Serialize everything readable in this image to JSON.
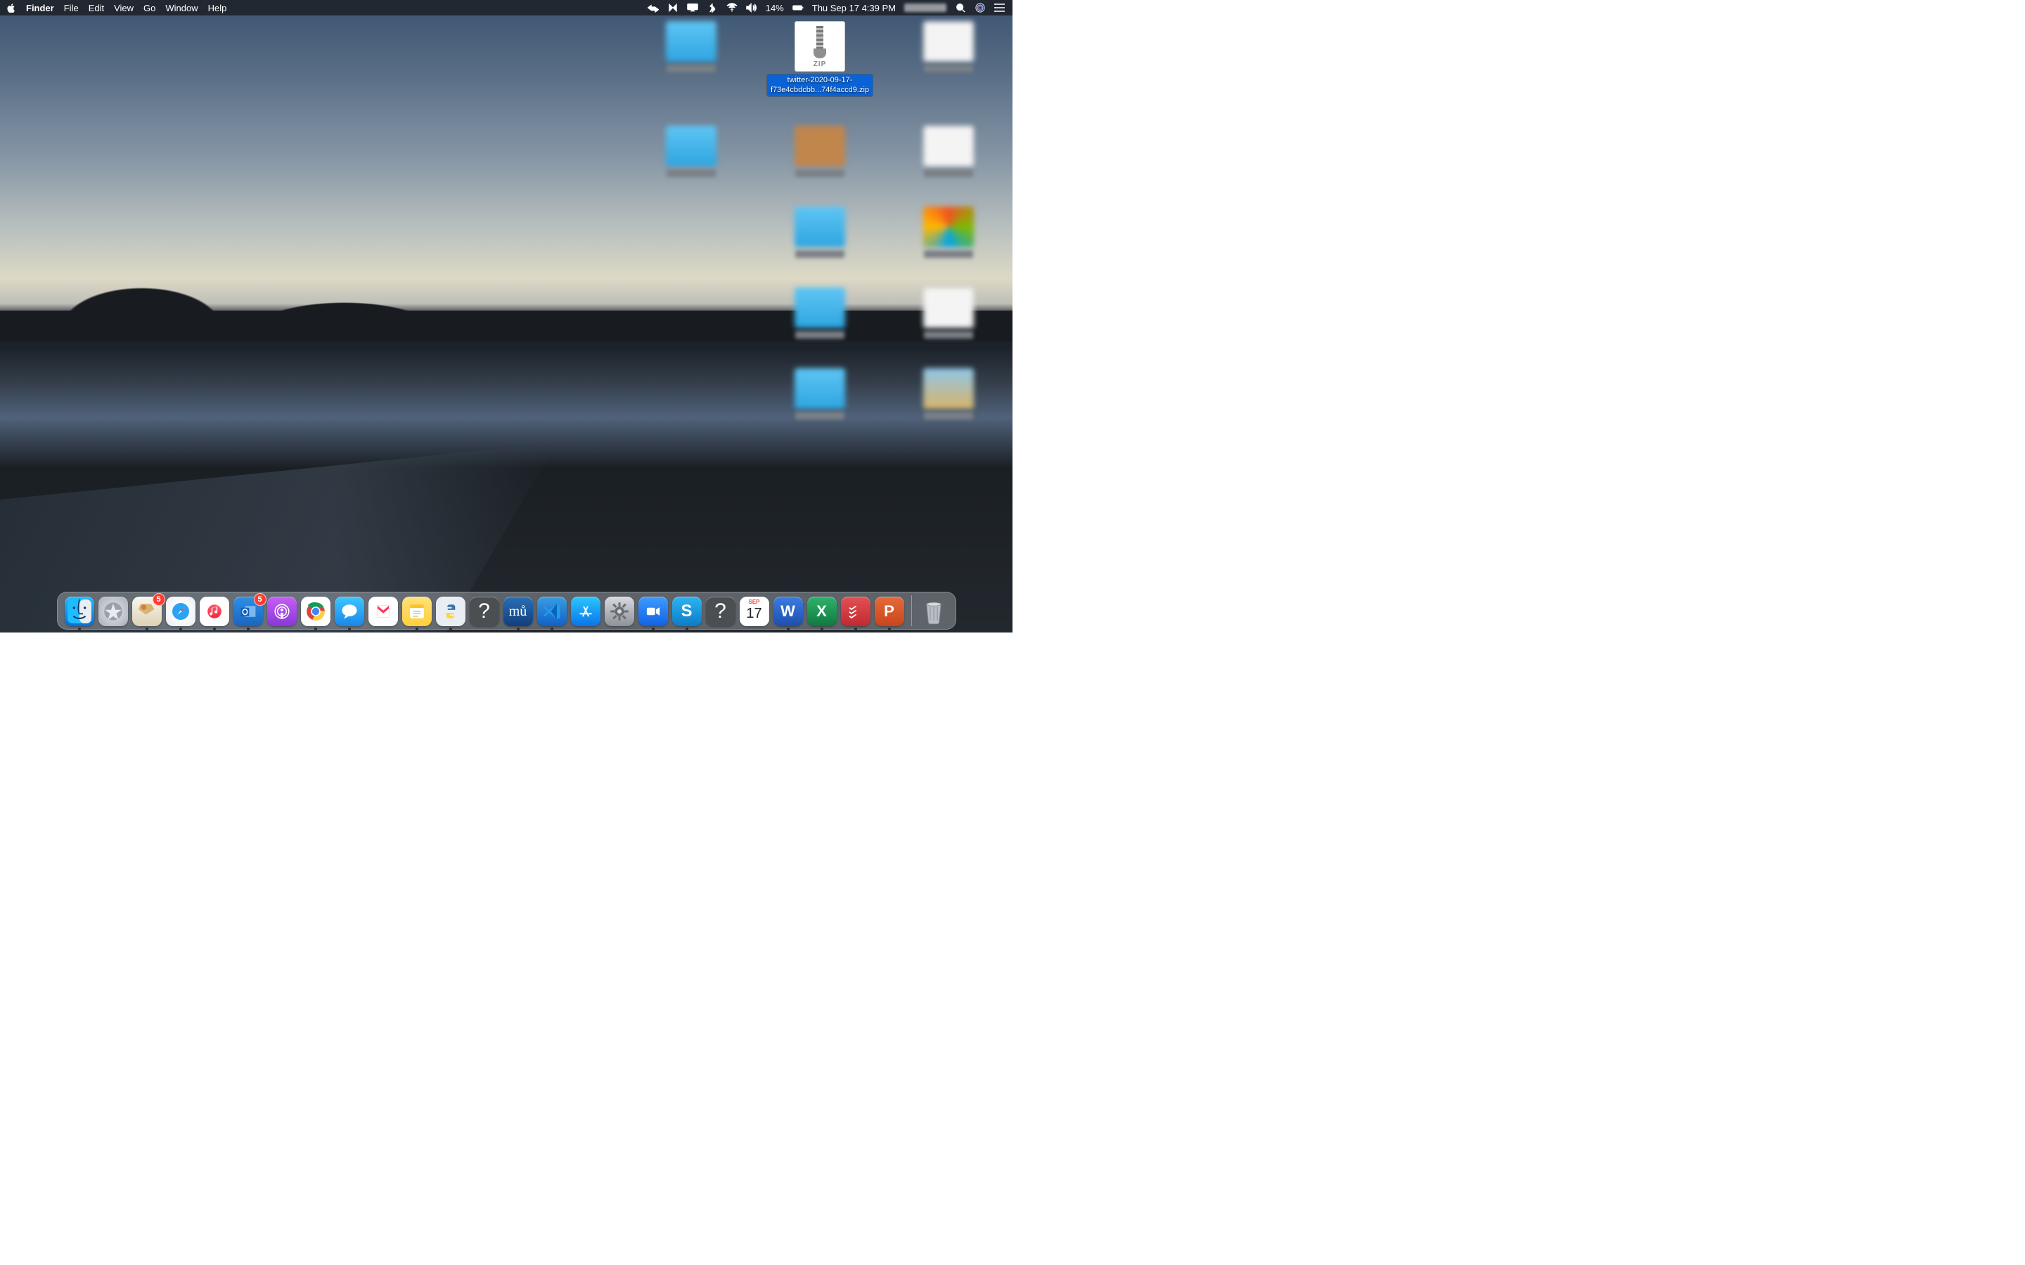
{
  "menubar": {
    "app": "Finder",
    "items": [
      "File",
      "Edit",
      "View",
      "Go",
      "Window",
      "Help"
    ],
    "battery_pct": "14%",
    "datetime": "Thu Sep 17  4:39 PM"
  },
  "selected_file": {
    "label": "twitter-2020-09-17-f73e4cbdcbb...74f4accd9.zip",
    "badge": "ZIP"
  },
  "calendar": {
    "month": "SEP",
    "day": "17"
  },
  "dock": {
    "mail_badge": "5",
    "outlook_badge": "5"
  },
  "dock_apps": [
    {
      "name": "finder",
      "running": true
    },
    {
      "name": "launchpad"
    },
    {
      "name": "mail",
      "running": true,
      "badge_key": "dock.mail_badge"
    },
    {
      "name": "safari",
      "running": true
    },
    {
      "name": "music",
      "running": true
    },
    {
      "name": "outlook",
      "running": true,
      "badge_key": "dock.outlook_badge"
    },
    {
      "name": "podcasts"
    },
    {
      "name": "chrome",
      "running": true
    },
    {
      "name": "messages",
      "running": true
    },
    {
      "name": "news"
    },
    {
      "name": "notes",
      "running": true
    },
    {
      "name": "idle",
      "running": true
    },
    {
      "name": "question"
    },
    {
      "name": "musescore",
      "running": true
    },
    {
      "name": "vscode",
      "running": true
    },
    {
      "name": "appstore"
    },
    {
      "name": "sysprefs"
    },
    {
      "name": "zoom",
      "running": true
    },
    {
      "name": "skype",
      "running": true
    },
    {
      "name": "question"
    },
    {
      "name": "cal"
    },
    {
      "name": "word",
      "running": true
    },
    {
      "name": "excel",
      "running": true
    },
    {
      "name": "todoist",
      "running": true
    },
    {
      "name": "ppt",
      "running": true
    }
  ]
}
